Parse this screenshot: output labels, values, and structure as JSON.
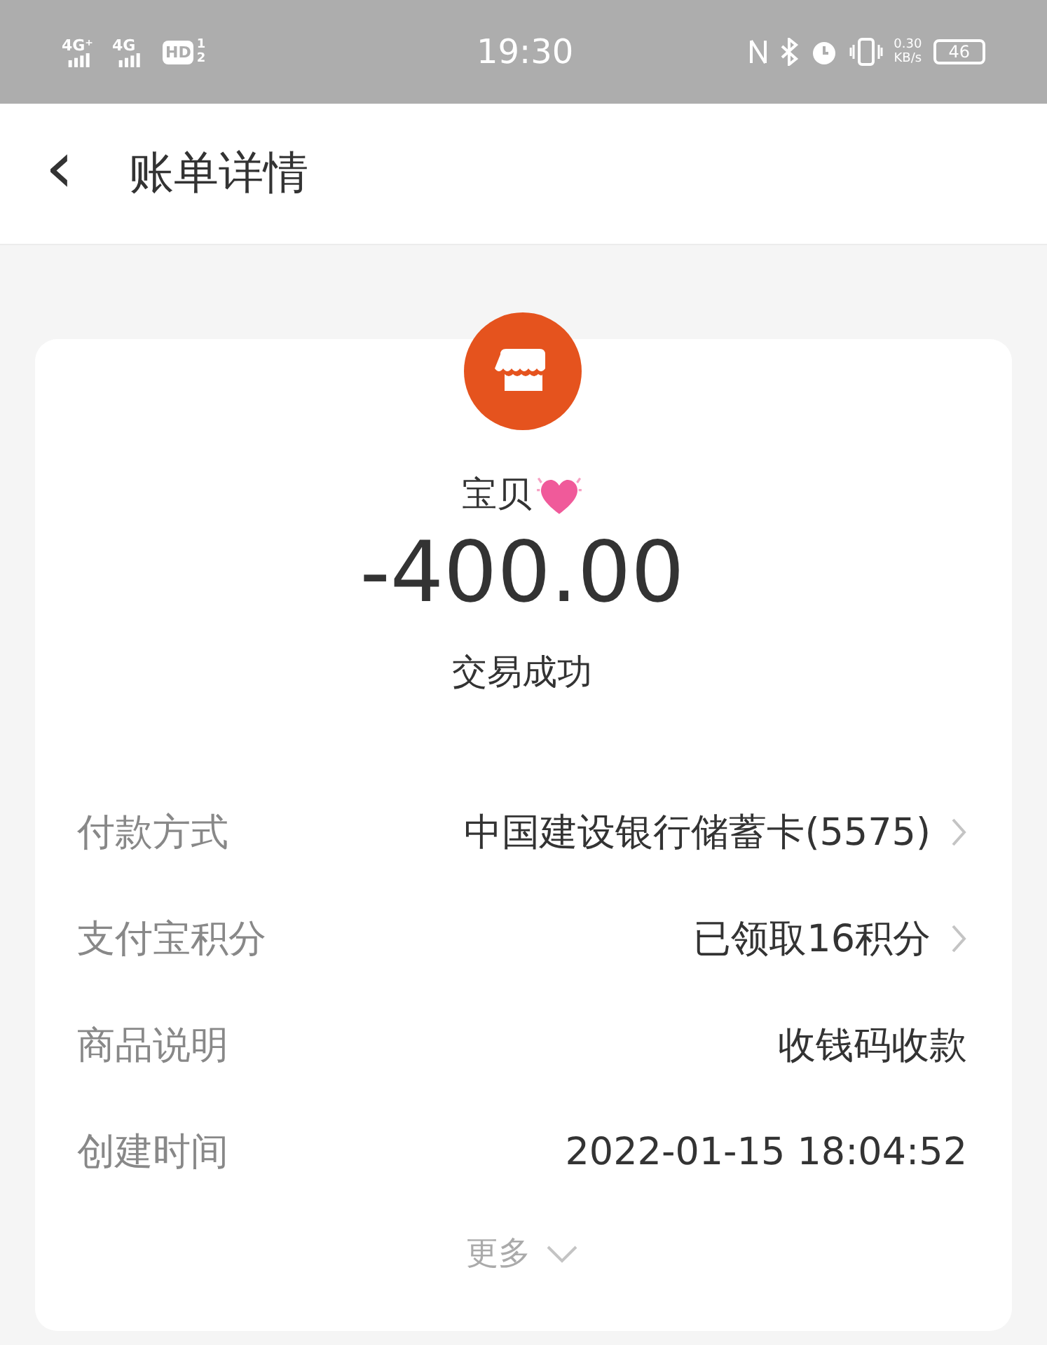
{
  "status_bar": {
    "sim1": "4G⁺",
    "sim2": "4G",
    "hd": "HD",
    "hd_slots": [
      "1",
      "2"
    ],
    "time": "19:30",
    "speed_value": "0.30",
    "speed_unit": "KB/s",
    "battery": "46"
  },
  "header": {
    "back": "‹",
    "title": "账单详情"
  },
  "bill": {
    "payee": "宝贝",
    "amount": "-400.00",
    "status": "交易成功",
    "rows": [
      {
        "label": "付款方式",
        "value": "中国建设银行储蓄卡(5575)",
        "link": true
      },
      {
        "label": "支付宝积分",
        "value": "已领取16积分",
        "link": true
      },
      {
        "label": "商品说明",
        "value": "收钱码收款",
        "link": false
      },
      {
        "label": "创建时间",
        "value": "2022-01-15 18:04:52",
        "link": false
      }
    ],
    "more": "更多"
  }
}
